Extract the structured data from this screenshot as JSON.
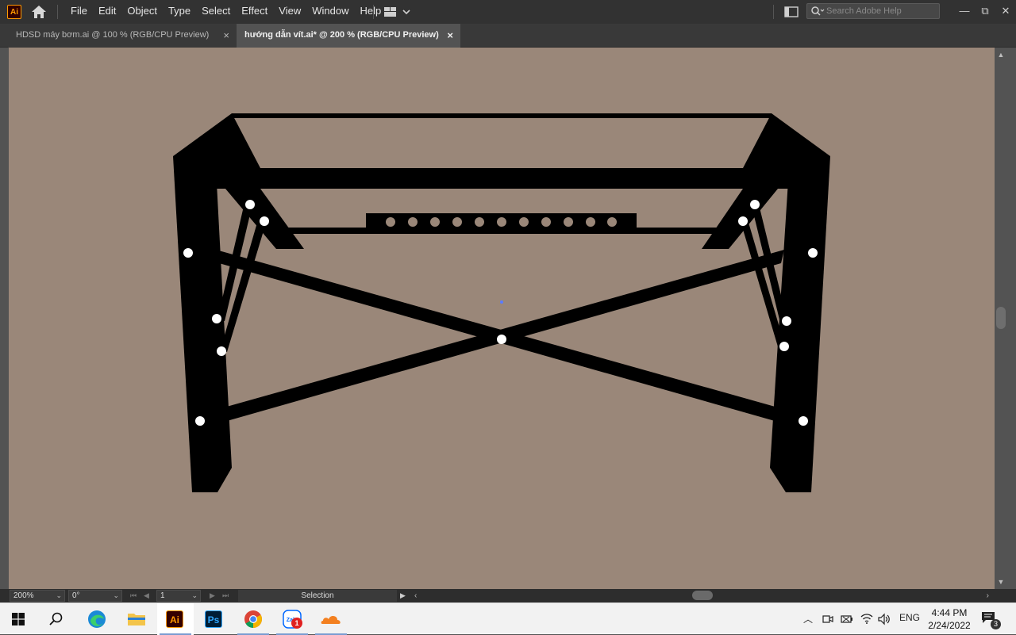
{
  "app": {
    "logo_text": "Ai"
  },
  "menu": [
    "File",
    "Edit",
    "Object",
    "Type",
    "Select",
    "Effect",
    "View",
    "Window",
    "Help"
  ],
  "search": {
    "placeholder": "Search Adobe Help"
  },
  "window_controls": {
    "minimize": "—",
    "restore": "⧉",
    "close": "✕"
  },
  "tabs": [
    {
      "label": "HDSD máy bơm.ai @ 100 % (RGB/CPU Preview)",
      "active": false,
      "close": "×"
    },
    {
      "label": "hướng dẫn vít.ai* @ 200 % (RGB/CPU Preview)",
      "active": true,
      "close": "×"
    }
  ],
  "status": {
    "zoom": "200%",
    "rotation": "0°",
    "artboard": "1",
    "tool": "Selection"
  },
  "taskbar": {
    "apps": [
      {
        "name": "windows-start-icon",
        "label": ""
      },
      {
        "name": "search-icon",
        "label": ""
      },
      {
        "name": "edge-icon",
        "label": ""
      },
      {
        "name": "file-explorer-icon",
        "label": ""
      },
      {
        "name": "illustrator-icon",
        "label": "Ai",
        "active": true
      },
      {
        "name": "photoshop-icon",
        "label": "Ps"
      },
      {
        "name": "chrome-icon",
        "label": ""
      },
      {
        "name": "zalo-icon",
        "label": "Zalo",
        "badge": "1"
      },
      {
        "name": "cloudflare-icon",
        "label": ""
      }
    ],
    "language": "ENG",
    "time": "4:44 PM",
    "date": "2/24/2022",
    "notifications": "3"
  },
  "colors": {
    "canvas": "#9a8779",
    "artwork": "#000000",
    "holes": "#ffffff",
    "accent": "#ff9a00"
  }
}
